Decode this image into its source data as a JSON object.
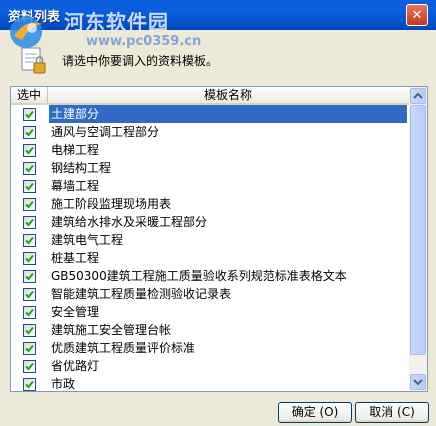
{
  "window": {
    "title": "资料列表",
    "close_label": "✕"
  },
  "watermark": {
    "line1": "河东软件园",
    "line2": "www.pc0359.cn"
  },
  "prompt": {
    "text": "请选中你要调入的资料模板。"
  },
  "table": {
    "columns": [
      "选中",
      "模板名称"
    ],
    "rows": [
      {
        "checked": true,
        "name": "土建部分",
        "selected": true
      },
      {
        "checked": true,
        "name": "通风与空调工程部分"
      },
      {
        "checked": true,
        "name": "电梯工程"
      },
      {
        "checked": true,
        "name": "钢结构工程"
      },
      {
        "checked": true,
        "name": "幕墙工程"
      },
      {
        "checked": true,
        "name": "施工阶段监理现场用表"
      },
      {
        "checked": true,
        "name": "建筑给水排水及采暖工程部分"
      },
      {
        "checked": true,
        "name": "建筑电气工程"
      },
      {
        "checked": true,
        "name": "桩基工程"
      },
      {
        "checked": true,
        "name": "GB50300建筑工程施工质量验收系列规范标准表格文本"
      },
      {
        "checked": true,
        "name": "智能建筑工程质量检测验收记录表"
      },
      {
        "checked": true,
        "name": "安全管理"
      },
      {
        "checked": true,
        "name": "建筑施工安全管理台帐"
      },
      {
        "checked": true,
        "name": "优质建筑工程质量评价标准"
      },
      {
        "checked": true,
        "name": "省优路灯"
      },
      {
        "checked": true,
        "name": "市政"
      }
    ]
  },
  "buttons": {
    "ok": "确定 (O)",
    "cancel": "取消 (C)"
  },
  "colors": {
    "titlebar": "#0A5BD8",
    "selection": "#316AC5",
    "check": "#21A121",
    "dialog_bg": "#ECE9D8"
  }
}
